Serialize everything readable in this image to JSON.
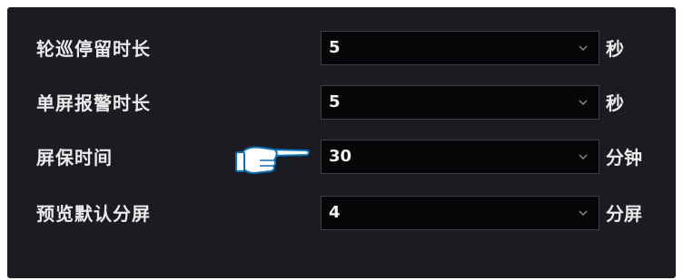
{
  "settings": [
    {
      "label": "轮巡停留时长",
      "value": "5",
      "unit": "秒"
    },
    {
      "label": "单屏报警时长",
      "value": "5",
      "unit": "秒"
    },
    {
      "label": "屏保时间",
      "value": "30",
      "unit": "分钟"
    },
    {
      "label": "预览默认分屏",
      "value": "4",
      "unit": "分屏"
    }
  ],
  "icons": {
    "dropdown": "chevron-down-icon",
    "pointer": "pointing-hand-icon"
  },
  "colors": {
    "panel_background": "#1b1c22",
    "field_background": "#060608",
    "text": "#eaeaea"
  }
}
